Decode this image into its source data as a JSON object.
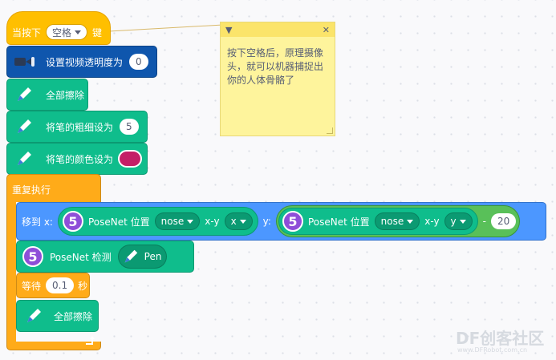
{
  "event_block": {
    "label_before": "当按下",
    "key": "空格",
    "label_after": "键"
  },
  "video_block": {
    "label": "设置视频透明度为",
    "value": "0"
  },
  "clear_block": {
    "label": "全部擦除"
  },
  "pen_size_block": {
    "label": "将笔的粗细设为",
    "value": "5"
  },
  "pen_color_block": {
    "label": "将笔的颜色设为",
    "color": "#c41f67"
  },
  "repeat_block": {
    "label": "重复执行"
  },
  "goto_block": {
    "label_x": "移到 x:",
    "label_y": "y:",
    "x_reporter": {
      "badge": "5",
      "label": "PoseNet 位置",
      "part": "nose",
      "coord_label": "x-y",
      "coord": "x"
    },
    "y_reporter": {
      "badge": "5",
      "label": "PoseNet 位置",
      "part": "nose",
      "coord_label": "x-y",
      "coord": "y"
    },
    "minus": "-",
    "offset": "20"
  },
  "detect_block": {
    "badge": "5",
    "label": "PoseNet 检测",
    "pen_label": "Pen"
  },
  "wait_block": {
    "label": "等待",
    "value": "0.1",
    "unit": "秒"
  },
  "clear_block2": {
    "label": "全部擦除"
  },
  "note": {
    "text": "按下空格后，原理摄像头，就可以机器捕捉出你的人体骨骼了",
    "collapse_icon": "caret-down-icon",
    "close_icon": "close-icon"
  },
  "watermark": {
    "brand": "DF创客社区",
    "url": "www.DFRobot.com.cn"
  },
  "colors": {
    "events": "#ffbf00",
    "video": "#0f56ad",
    "pen": "#0fbd8c",
    "control": "#ffab19",
    "motion": "#4c97ff",
    "operator": "#59c059",
    "posenet": "#8e4ed8"
  }
}
